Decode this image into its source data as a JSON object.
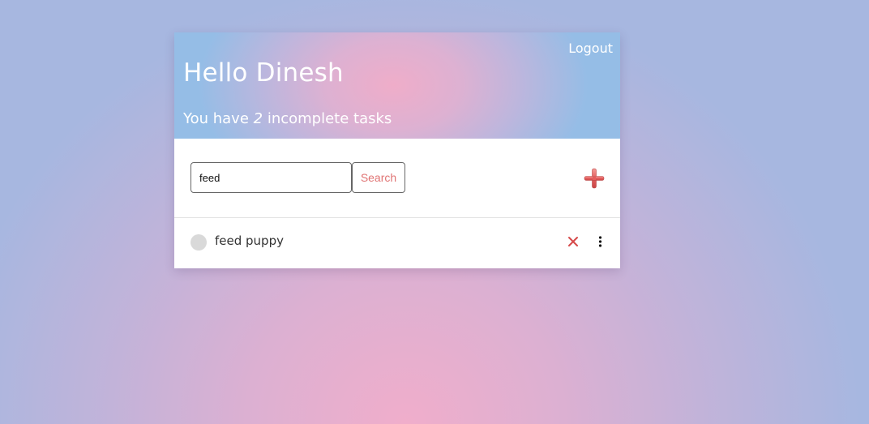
{
  "header": {
    "logout_label": "Logout",
    "greeting": "Hello Dinesh",
    "summary_prefix": "You have ",
    "incomplete_count": "2",
    "summary_suffix": " incomplete tasks"
  },
  "toolbar": {
    "search_value": "feed",
    "search_button_label": "Search",
    "add_icon": "plus-icon"
  },
  "tasks": [
    {
      "text": "feed puppy",
      "completed": false,
      "delete_icon": "close-icon",
      "menu_icon": "kebab-menu-icon"
    }
  ],
  "colors": {
    "accent": "#e07474",
    "delete": "#d64a4a",
    "checkbox": "#d9d9d9"
  }
}
